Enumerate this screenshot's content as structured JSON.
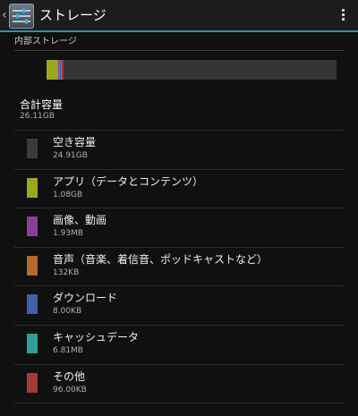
{
  "action_bar": {
    "title": "ストレージ",
    "app_icon": "settings-sliders-icon",
    "menu_icon": "overflow-menu-icon"
  },
  "section": {
    "header": "内部ストレージ"
  },
  "usage_bar": {
    "segments": [
      {
        "name": "アプリ（データとコンテンツ）",
        "color": "#9aa81f",
        "fraction": 0.041
      },
      {
        "name": "画像、動画",
        "color": "#8c3f99",
        "fraction": 0.003
      },
      {
        "name": "音声（音楽、着信音、ポッドキャストなど）",
        "color": "#b56a2a",
        "fraction": 0.003
      },
      {
        "name": "ダウンロード",
        "color": "#3f5fa8",
        "fraction": 0.003
      },
      {
        "name": "キャッシュデータ",
        "color": "#2f9e9b",
        "fraction": 0.003
      },
      {
        "name": "その他",
        "color": "#a23a3a",
        "fraction": 0.006
      }
    ],
    "free_color": "#353535"
  },
  "total": {
    "label": "合計容量",
    "value": "26.11GB"
  },
  "categories": [
    {
      "label": "空き容量",
      "size": "24.91GB",
      "color": "#3a3a3a"
    },
    {
      "label": "アプリ（データとコンテンツ）",
      "size": "1.08GB",
      "color": "#9aa81f"
    },
    {
      "label": "画像、動画",
      "size": "1.93MB",
      "color": "#8c3f99"
    },
    {
      "label": "音声（音楽、着信音、ポッドキャストなど）",
      "size": "132KB",
      "color": "#b56a2a"
    },
    {
      "label": "ダウンロード",
      "size": "8.00KB",
      "color": "#3f5fa8"
    },
    {
      "label": "キャッシュデータ",
      "size": "6.81MB",
      "color": "#2f9e9b"
    },
    {
      "label": "その他",
      "size": "96.00KB",
      "color": "#a23a3a"
    }
  ]
}
